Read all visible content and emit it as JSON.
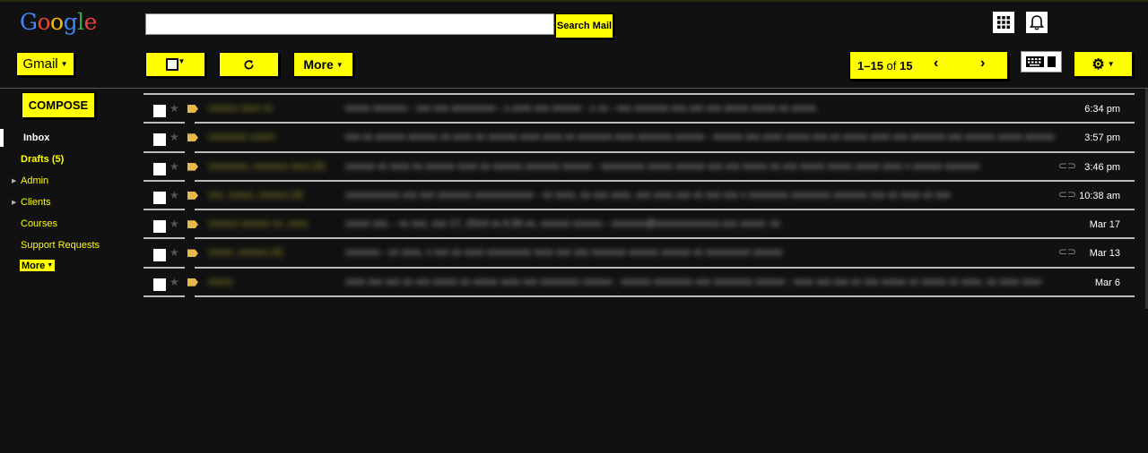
{
  "header": {
    "logo_letters": [
      "G",
      "o",
      "o",
      "g",
      "l",
      "e"
    ],
    "search_placeholder": "",
    "search_button": "Search Mail"
  },
  "toolbar": {
    "app_switcher": "Gmail",
    "more_label": "More",
    "pager_range": "1–15",
    "pager_of": "of",
    "pager_total": "15"
  },
  "sidebar": {
    "compose": "COMPOSE",
    "items": [
      {
        "label": "Inbox"
      },
      {
        "label": "Drafts (5)"
      },
      {
        "label": "Admin"
      },
      {
        "label": "Clients"
      },
      {
        "label": "Courses"
      },
      {
        "label": "Support Requests"
      }
    ],
    "more": "More"
  },
  "emails": [
    {
      "date": "6:34 pm"
    },
    {
      "date": "3:57 pm"
    },
    {
      "date": "3:46 pm"
    },
    {
      "date": "10:38 am"
    },
    {
      "date": "Mar 17"
    },
    {
      "date": "Mar 13"
    },
    {
      "date": "Mar 6"
    }
  ],
  "colors": {
    "accent": "#ffff00",
    "background": "#111111",
    "label_tag": "#e6b84a"
  }
}
